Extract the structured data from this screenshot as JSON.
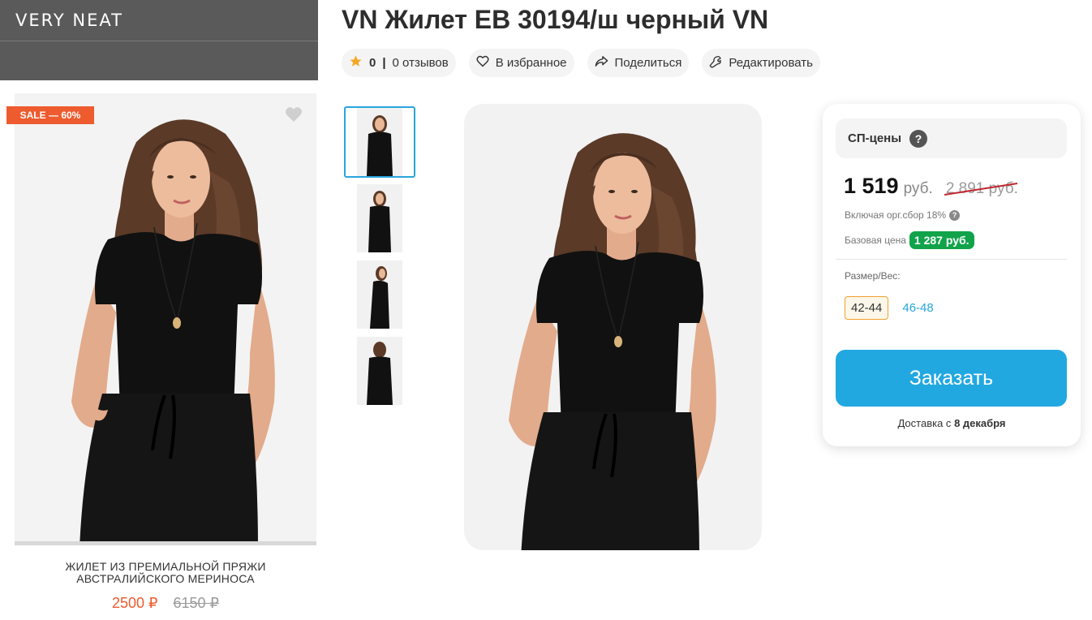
{
  "brand": {
    "name": "VERY NEAT"
  },
  "promo": {
    "badge": "SALE — 60%",
    "title_line1": "ЖИЛЕТ ИЗ ПРЕМИАЛЬНОЙ ПРЯЖИ",
    "title_line2": "АВСТРАЛИЙСКОГО МЕРИНОСА",
    "price_new": "2500 ₽",
    "price_old": "6150 ₽"
  },
  "product": {
    "title": "VN Жилет ЕВ 30194/ш черный VN",
    "rating": "0",
    "reviews": "0 отзывов",
    "favorite_label": "В избранное",
    "share_label": "Поделиться",
    "edit_label": "Редактировать"
  },
  "thumbnails": [
    {
      "label": "thumb-1",
      "active": true
    },
    {
      "label": "thumb-2",
      "active": false
    },
    {
      "label": "thumb-3",
      "active": false
    },
    {
      "label": "thumb-4",
      "active": false
    }
  ],
  "pricing": {
    "sp_label": "СП-цены",
    "help_glyph": "?",
    "price": "1 519",
    "currency": "руб.",
    "old_price": "2 891 руб.",
    "fee_text": "Включая орг.сбор 18%",
    "base_label": "Базовая цена",
    "base_price": "1 287 руб.",
    "size_label": "Размер/Вес:",
    "sizes": [
      "42-44",
      "46-48"
    ],
    "selected_size": "42-44",
    "order_label": "Заказать",
    "delivery_prefix": "Доставка с",
    "delivery_date": "8 декабря"
  },
  "colors": {
    "accent_blue": "#22a8e1",
    "sale_orange": "#ed5b2e",
    "base_green": "#10a34a",
    "star": "#f5a623"
  }
}
